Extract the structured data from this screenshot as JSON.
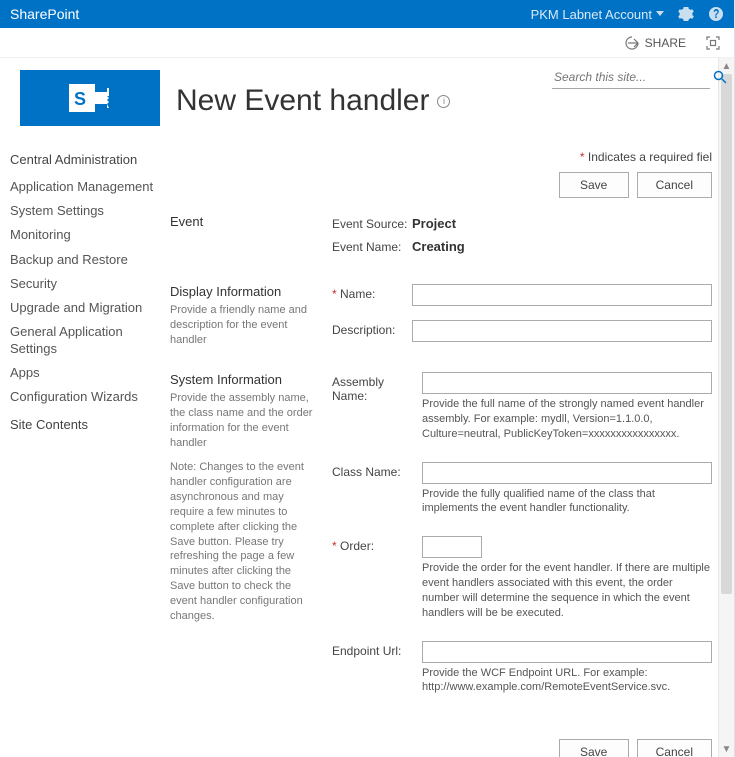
{
  "suite": {
    "product": "SharePoint",
    "account": "PKM Labnet Account"
  },
  "ribbon": {
    "share": "SHARE"
  },
  "search": {
    "placeholder": "Search this site..."
  },
  "page": {
    "title": "New Event handler"
  },
  "nav": {
    "root": "Central Administration",
    "items": [
      "Application Management",
      "System Settings",
      "Monitoring",
      "Backup and Restore",
      "Security",
      "Upgrade and Migration",
      "General Application Settings",
      "Apps",
      "Configuration Wizards"
    ],
    "root2": "Site Contents"
  },
  "form": {
    "required_note": "Indicates a required fiel",
    "save": "Save",
    "cancel": "Cancel",
    "sections": {
      "event": {
        "title": "Event",
        "source_label": "Event Source:",
        "source_value": "Project",
        "name_label": "Event Name:",
        "name_value": "Creating"
      },
      "display": {
        "title": "Display Information",
        "desc": "Provide a friendly name and description for the event handler",
        "name_label": "Name:",
        "desc_label": "Description:"
      },
      "system": {
        "title": "System Information",
        "desc": "Provide the assembly name, the class name and the order information for the event handler",
        "note": "Note: Changes to the event handler configuration are asynchronous and may require a few minutes to complete after clicking the Save button. Please try refreshing the page a few minutes after clicking the Save button to check the event handler configuration changes.",
        "assembly_label": "Assembly Name:",
        "assembly_help": "Provide the full name of the strongly named event handler assembly. For example: mydll, Version=1.1.0.0, Culture=neutral, PublicKeyToken=xxxxxxxxxxxxxxxx.",
        "class_label": "Class Name:",
        "class_help": "Provide the fully qualified name of the class that implements the event handler functionality.",
        "order_label": "Order:",
        "order_help": "Provide the order for the event handler. If there are multiple event handlers associated with this event, the order number will determine the sequence in which the event handlers will be be executed.",
        "endpoint_label": "Endpoint Url:",
        "endpoint_help": "Provide the WCF Endpoint URL. For example: http://www.example.com/RemoteEventService.svc."
      }
    }
  }
}
